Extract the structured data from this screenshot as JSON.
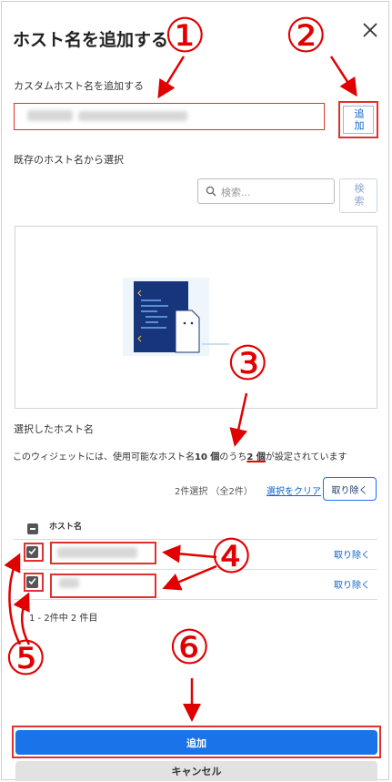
{
  "dialog": {
    "title": "ホスト名を追加する",
    "close_icon": "close-icon"
  },
  "custom": {
    "label": "カスタムホスト名を追加する",
    "add_label": "追加"
  },
  "existing": {
    "label": "既存のホスト名から選択",
    "search_placeholder": "検索...",
    "search_button": "検索"
  },
  "selected": {
    "label": "選択したホスト名",
    "info_prefix": "このウィジェットには、使用可能なホスト名",
    "info_total": "10 個",
    "info_mid": "のうち",
    "info_count": "2 個",
    "info_suffix": "が設定されています",
    "selection_count": "2件選択 （全2件）",
    "clear_link": "選択をクリア",
    "remove_button": "取り除く",
    "column_header": "ホスト名",
    "rows": [
      {
        "remove": "取り除く",
        "checked": true
      },
      {
        "remove": "取り除く",
        "checked": true
      }
    ],
    "pager": "1 - 2件中 2 件目"
  },
  "footer": {
    "add_button": "追加",
    "cancel_button": "キャンセル"
  },
  "annotations": {
    "n1": "①",
    "n2": "②",
    "n3": "③",
    "n4": "④",
    "n5": "⑤",
    "n6": "⑥",
    "color": "#e00000"
  }
}
